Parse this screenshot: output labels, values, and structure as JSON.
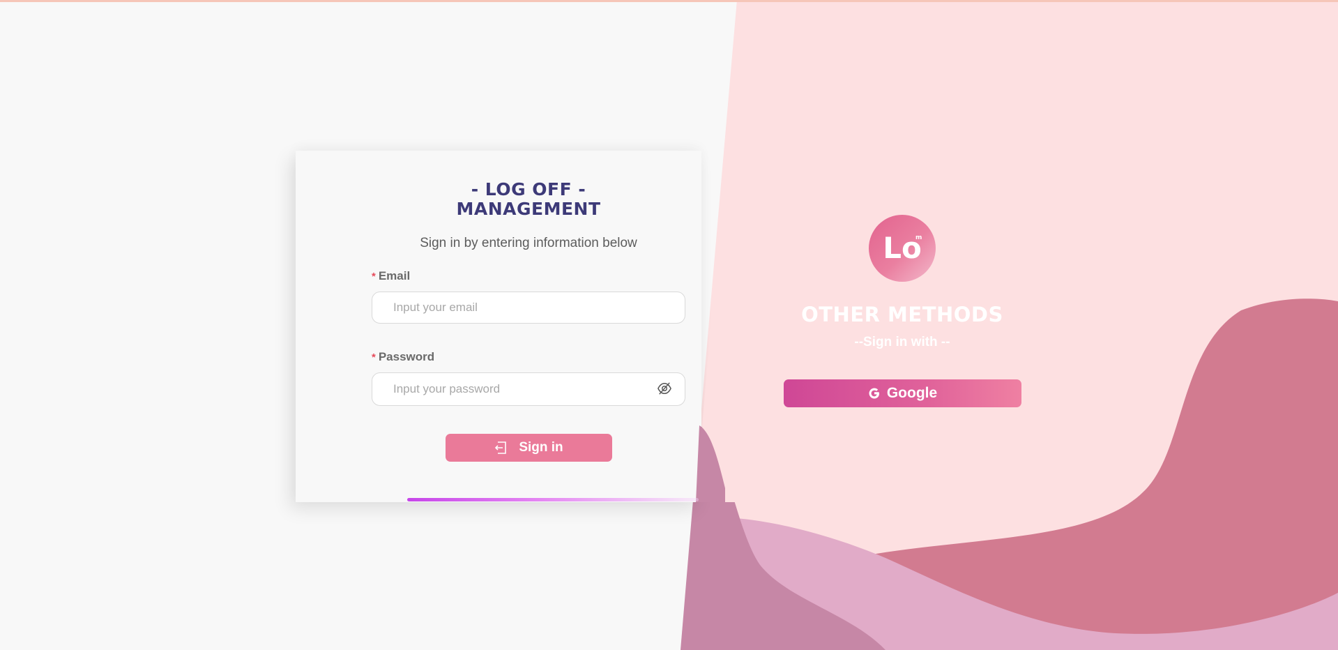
{
  "app": {
    "title": "- LOG OFF - MANAGEMENT",
    "title_line1": "- LOG OFF -",
    "title_line2": "MANAGEMENT"
  },
  "form": {
    "subtitle": "Sign in by entering information below",
    "email": {
      "required_mark": "*",
      "label": "Email",
      "placeholder": "Input your email",
      "value": ""
    },
    "password": {
      "required_mark": "*",
      "label": "Password",
      "placeholder": "Input your password",
      "value": "",
      "toggle_icon": "eye-invisible-icon"
    },
    "submit": {
      "label": "Sign in",
      "icon": "login-icon"
    }
  },
  "other": {
    "logo_text": "Lo",
    "logo_sup": "m",
    "title": "OTHER METHODS",
    "subtitle": "--Sign in with --",
    "google": {
      "label": "Google",
      "icon": "google-icon"
    }
  },
  "colors": {
    "title": "#3d3a78",
    "accent": "#ea7a99",
    "right_bg": "#fde0e1",
    "wave_dark": "#d27b90",
    "wave_light": "#e1abc8",
    "wave_mauve": "#c687a6",
    "progress": "#c646e9",
    "required": "#e54b5b"
  }
}
